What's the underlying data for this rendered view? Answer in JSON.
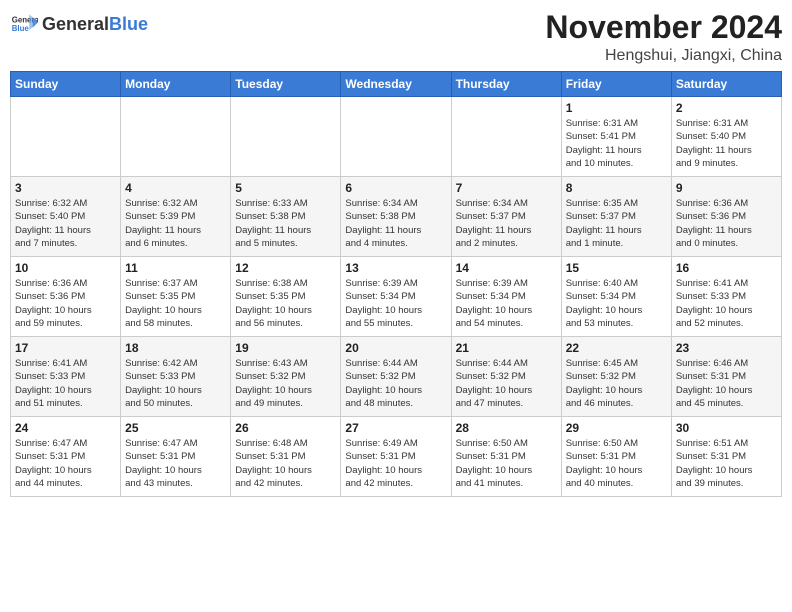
{
  "header": {
    "logo_general": "General",
    "logo_blue": "Blue",
    "month": "November 2024",
    "location": "Hengshui, Jiangxi, China"
  },
  "weekdays": [
    "Sunday",
    "Monday",
    "Tuesday",
    "Wednesday",
    "Thursday",
    "Friday",
    "Saturday"
  ],
  "weeks": [
    [
      {
        "day": "",
        "detail": ""
      },
      {
        "day": "",
        "detail": ""
      },
      {
        "day": "",
        "detail": ""
      },
      {
        "day": "",
        "detail": ""
      },
      {
        "day": "",
        "detail": ""
      },
      {
        "day": "1",
        "detail": "Sunrise: 6:31 AM\nSunset: 5:41 PM\nDaylight: 11 hours\nand 10 minutes."
      },
      {
        "day": "2",
        "detail": "Sunrise: 6:31 AM\nSunset: 5:40 PM\nDaylight: 11 hours\nand 9 minutes."
      }
    ],
    [
      {
        "day": "3",
        "detail": "Sunrise: 6:32 AM\nSunset: 5:40 PM\nDaylight: 11 hours\nand 7 minutes."
      },
      {
        "day": "4",
        "detail": "Sunrise: 6:32 AM\nSunset: 5:39 PM\nDaylight: 11 hours\nand 6 minutes."
      },
      {
        "day": "5",
        "detail": "Sunrise: 6:33 AM\nSunset: 5:38 PM\nDaylight: 11 hours\nand 5 minutes."
      },
      {
        "day": "6",
        "detail": "Sunrise: 6:34 AM\nSunset: 5:38 PM\nDaylight: 11 hours\nand 4 minutes."
      },
      {
        "day": "7",
        "detail": "Sunrise: 6:34 AM\nSunset: 5:37 PM\nDaylight: 11 hours\nand 2 minutes."
      },
      {
        "day": "8",
        "detail": "Sunrise: 6:35 AM\nSunset: 5:37 PM\nDaylight: 11 hours\nand 1 minute."
      },
      {
        "day": "9",
        "detail": "Sunrise: 6:36 AM\nSunset: 5:36 PM\nDaylight: 11 hours\nand 0 minutes."
      }
    ],
    [
      {
        "day": "10",
        "detail": "Sunrise: 6:36 AM\nSunset: 5:36 PM\nDaylight: 10 hours\nand 59 minutes."
      },
      {
        "day": "11",
        "detail": "Sunrise: 6:37 AM\nSunset: 5:35 PM\nDaylight: 10 hours\nand 58 minutes."
      },
      {
        "day": "12",
        "detail": "Sunrise: 6:38 AM\nSunset: 5:35 PM\nDaylight: 10 hours\nand 56 minutes."
      },
      {
        "day": "13",
        "detail": "Sunrise: 6:39 AM\nSunset: 5:34 PM\nDaylight: 10 hours\nand 55 minutes."
      },
      {
        "day": "14",
        "detail": "Sunrise: 6:39 AM\nSunset: 5:34 PM\nDaylight: 10 hours\nand 54 minutes."
      },
      {
        "day": "15",
        "detail": "Sunrise: 6:40 AM\nSunset: 5:34 PM\nDaylight: 10 hours\nand 53 minutes."
      },
      {
        "day": "16",
        "detail": "Sunrise: 6:41 AM\nSunset: 5:33 PM\nDaylight: 10 hours\nand 52 minutes."
      }
    ],
    [
      {
        "day": "17",
        "detail": "Sunrise: 6:41 AM\nSunset: 5:33 PM\nDaylight: 10 hours\nand 51 minutes."
      },
      {
        "day": "18",
        "detail": "Sunrise: 6:42 AM\nSunset: 5:33 PM\nDaylight: 10 hours\nand 50 minutes."
      },
      {
        "day": "19",
        "detail": "Sunrise: 6:43 AM\nSunset: 5:32 PM\nDaylight: 10 hours\nand 49 minutes."
      },
      {
        "day": "20",
        "detail": "Sunrise: 6:44 AM\nSunset: 5:32 PM\nDaylight: 10 hours\nand 48 minutes."
      },
      {
        "day": "21",
        "detail": "Sunrise: 6:44 AM\nSunset: 5:32 PM\nDaylight: 10 hours\nand 47 minutes."
      },
      {
        "day": "22",
        "detail": "Sunrise: 6:45 AM\nSunset: 5:32 PM\nDaylight: 10 hours\nand 46 minutes."
      },
      {
        "day": "23",
        "detail": "Sunrise: 6:46 AM\nSunset: 5:31 PM\nDaylight: 10 hours\nand 45 minutes."
      }
    ],
    [
      {
        "day": "24",
        "detail": "Sunrise: 6:47 AM\nSunset: 5:31 PM\nDaylight: 10 hours\nand 44 minutes."
      },
      {
        "day": "25",
        "detail": "Sunrise: 6:47 AM\nSunset: 5:31 PM\nDaylight: 10 hours\nand 43 minutes."
      },
      {
        "day": "26",
        "detail": "Sunrise: 6:48 AM\nSunset: 5:31 PM\nDaylight: 10 hours\nand 42 minutes."
      },
      {
        "day": "27",
        "detail": "Sunrise: 6:49 AM\nSunset: 5:31 PM\nDaylight: 10 hours\nand 42 minutes."
      },
      {
        "day": "28",
        "detail": "Sunrise: 6:50 AM\nSunset: 5:31 PM\nDaylight: 10 hours\nand 41 minutes."
      },
      {
        "day": "29",
        "detail": "Sunrise: 6:50 AM\nSunset: 5:31 PM\nDaylight: 10 hours\nand 40 minutes."
      },
      {
        "day": "30",
        "detail": "Sunrise: 6:51 AM\nSunset: 5:31 PM\nDaylight: 10 hours\nand 39 minutes."
      }
    ]
  ]
}
